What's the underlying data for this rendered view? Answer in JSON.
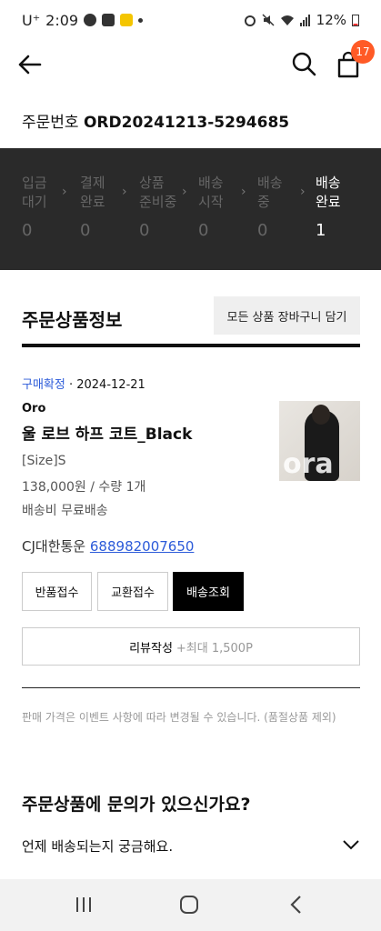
{
  "status_bar": {
    "carrier": "U⁺",
    "time": "2:09",
    "battery": "12%"
  },
  "header": {
    "cart_badge": "17"
  },
  "order": {
    "label": "주문번호",
    "number": "ORD20241213-5294685"
  },
  "steps": [
    {
      "line1": "입금",
      "line2": "대기",
      "count": "0",
      "active": false
    },
    {
      "line1": "결제",
      "line2": "완료",
      "count": "0",
      "active": false
    },
    {
      "line1": "상품",
      "line2": "준비중",
      "count": "0",
      "active": false
    },
    {
      "line1": "배송",
      "line2": "시작",
      "count": "0",
      "active": false
    },
    {
      "line1": "배송",
      "line2": "중",
      "count": "0",
      "active": false
    },
    {
      "line1": "배송",
      "line2": "완료",
      "count": "1",
      "active": true
    }
  ],
  "section": {
    "title": "주문상품정보",
    "cart_all_label": "모든 상품 장바구니 담기"
  },
  "item": {
    "status": "구매확정",
    "date": "· 2024-12-21",
    "brand": "Oro",
    "name": "울 로브 하프 코트_Black",
    "option": "[Size]S",
    "price_qty": "138,000원 / 수량 1개",
    "shipping": "배송비 무료배송",
    "courier": "CJ대한통운",
    "tracking": "688982007650",
    "thumb_watermark": "ora"
  },
  "buttons": {
    "return": "반품접수",
    "exchange": "교환접수",
    "track": "배송조회",
    "review": "리뷰작성",
    "review_points": "+최대 1,500P"
  },
  "notice": "판매 가격은 이벤트 사항에 따라 변경될 수 있습니다. (품절상품 제외)",
  "inquiry": {
    "title": "주문상품에 문의가 있으신가요?",
    "faq_1": "언제 배송되는지 궁금해요."
  },
  "colors": {
    "accent_blue": "#2c5bd9",
    "badge_orange": "#ff5a26",
    "stepper_bg": "#2a2a2a"
  }
}
